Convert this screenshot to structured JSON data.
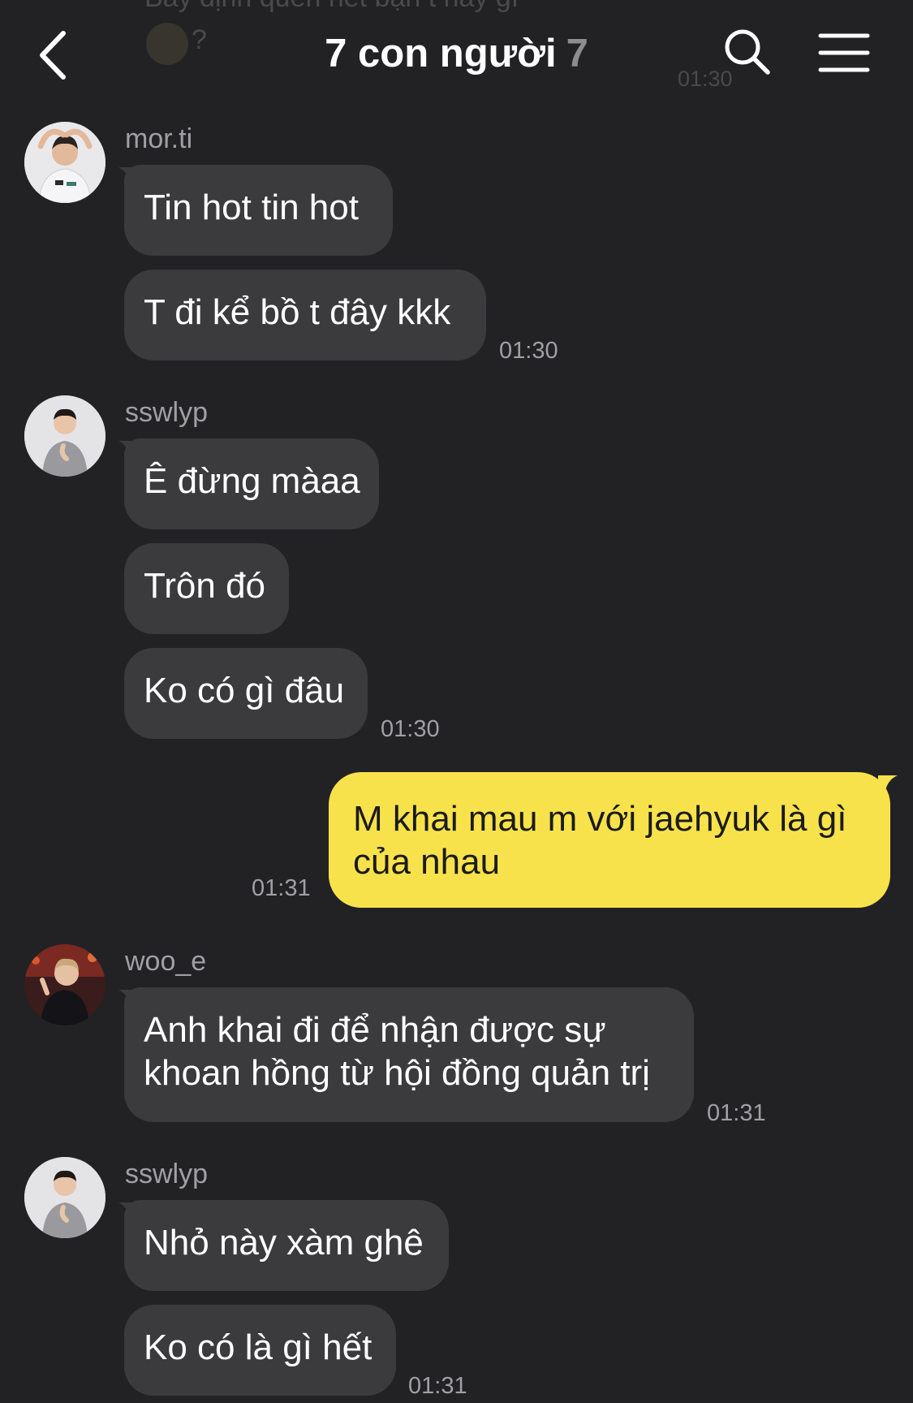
{
  "header": {
    "faded_prev_text": "Bây định quên hết bạn t này gì",
    "faded_prev_q": "?",
    "faded_prev_time": "01:30",
    "title": "7 con người",
    "member_count": "7"
  },
  "messages": {
    "g1": {
      "sender": "mor.ti",
      "b1": "Tin hot tin hot",
      "b2": "T đi kể bồ t đây kkk",
      "time": "01:30"
    },
    "g2": {
      "sender": "sswlyp",
      "b1": "Ê đừng màaa",
      "b2": "Trôn đó",
      "b3": "Ko có gì đâu",
      "time": "01:30"
    },
    "mine": {
      "line1": "M khai mau m với jaehyuk là gì",
      "line2": "của nhau",
      "time": "01:31"
    },
    "g3": {
      "sender": "woo_e",
      "line1": "Anh khai đi để nhận được sự",
      "line2": "khoan hồng từ hội đồng quản trị",
      "time": "01:31"
    },
    "g4": {
      "sender": "sswlyp",
      "b1": "Nhỏ này xàm ghê",
      "b2": "Ko có là gì hết",
      "time": "01:31"
    }
  },
  "colors": {
    "background": "#222224",
    "bubble_other": "#3b3b3e",
    "bubble_mine": "#f8e24b",
    "secondary_text": "#a0a0a4"
  },
  "icons": [
    "back-icon",
    "search-icon",
    "menu-icon"
  ]
}
